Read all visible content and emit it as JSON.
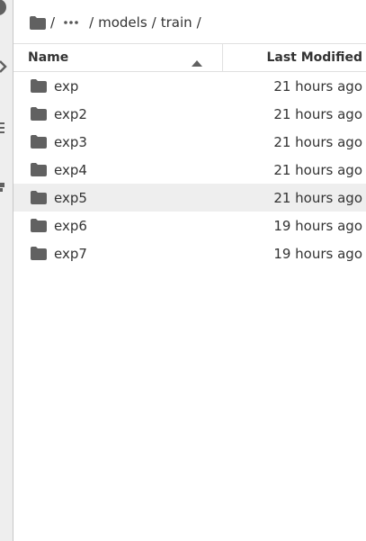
{
  "breadcrumbs": {
    "root_sep": "/",
    "sep2": "/",
    "sep3": "/",
    "sep4": "/",
    "items": [
      "models",
      "train"
    ]
  },
  "header": {
    "name_label": "Name",
    "modified_label": "Last Modified",
    "sort": "ascending"
  },
  "files": [
    {
      "name": "exp",
      "modified": "21 hours ago",
      "type": "folder"
    },
    {
      "name": "exp2",
      "modified": "21 hours ago",
      "type": "folder"
    },
    {
      "name": "exp3",
      "modified": "21 hours ago",
      "type": "folder"
    },
    {
      "name": "exp4",
      "modified": "21 hours ago",
      "type": "folder"
    },
    {
      "name": "exp5",
      "modified": "21 hours ago",
      "type": "folder",
      "selected": true
    },
    {
      "name": "exp6",
      "modified": "19 hours ago",
      "type": "folder"
    },
    {
      "name": "exp7",
      "modified": "19 hours ago",
      "type": "folder"
    }
  ],
  "colors": {
    "icon": "#616161",
    "selected_row": "#eeeeee",
    "border": "#e0e0e0"
  }
}
